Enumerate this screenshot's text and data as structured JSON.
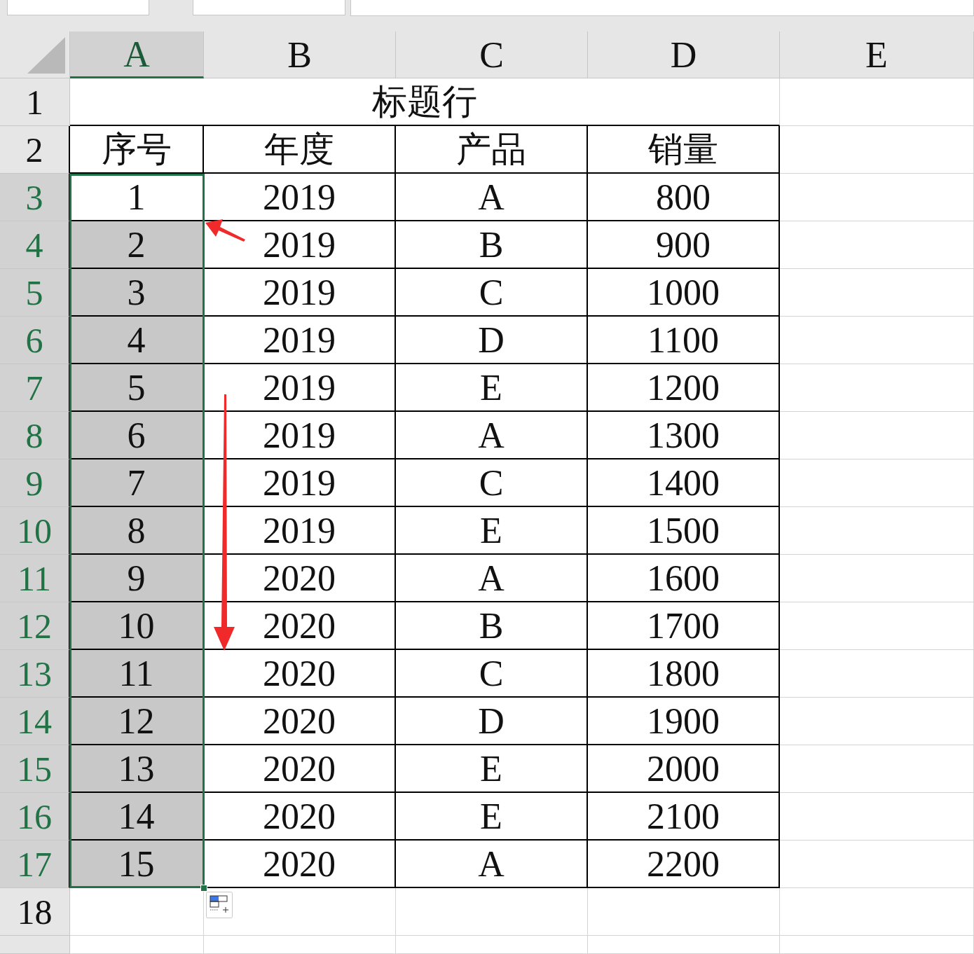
{
  "columns": [
    {
      "label": "A",
      "selected": true
    },
    {
      "label": "B",
      "selected": false
    },
    {
      "label": "C",
      "selected": false
    },
    {
      "label": "D",
      "selected": false
    },
    {
      "label": "E",
      "selected": false
    }
  ],
  "title": "标题行",
  "header_row": {
    "number": "2",
    "cells": [
      "序号",
      "年度",
      "产品",
      "销量"
    ]
  },
  "title_row_number": "1",
  "rows": [
    {
      "number": "3",
      "selected": true,
      "active": true,
      "cells": [
        "1",
        "2019",
        "A",
        "800"
      ]
    },
    {
      "number": "4",
      "selected": true,
      "active": false,
      "cells": [
        "2",
        "2019",
        "B",
        "900"
      ]
    },
    {
      "number": "5",
      "selected": true,
      "active": false,
      "cells": [
        "3",
        "2019",
        "C",
        "1000"
      ]
    },
    {
      "number": "6",
      "selected": true,
      "active": false,
      "cells": [
        "4",
        "2019",
        "D",
        "1100"
      ]
    },
    {
      "number": "7",
      "selected": true,
      "active": false,
      "cells": [
        "5",
        "2019",
        "E",
        "1200"
      ]
    },
    {
      "number": "8",
      "selected": true,
      "active": false,
      "cells": [
        "6",
        "2019",
        "A",
        "1300"
      ]
    },
    {
      "number": "9",
      "selected": true,
      "active": false,
      "cells": [
        "7",
        "2019",
        "C",
        "1400"
      ]
    },
    {
      "number": "10",
      "selected": true,
      "active": false,
      "cells": [
        "8",
        "2019",
        "E",
        "1500"
      ]
    },
    {
      "number": "11",
      "selected": true,
      "active": false,
      "cells": [
        "9",
        "2020",
        "A",
        "1600"
      ]
    },
    {
      "number": "12",
      "selected": true,
      "active": false,
      "cells": [
        "10",
        "2020",
        "B",
        "1700"
      ]
    },
    {
      "number": "13",
      "selected": true,
      "active": false,
      "cells": [
        "11",
        "2020",
        "C",
        "1800"
      ]
    },
    {
      "number": "14",
      "selected": true,
      "active": false,
      "cells": [
        "12",
        "2020",
        "D",
        "1900"
      ]
    },
    {
      "number": "15",
      "selected": true,
      "active": false,
      "cells": [
        "13",
        "2020",
        "E",
        "2000"
      ]
    },
    {
      "number": "16",
      "selected": true,
      "active": false,
      "cells": [
        "14",
        "2020",
        "E",
        "2100"
      ]
    },
    {
      "number": "17",
      "selected": true,
      "active": false,
      "cells": [
        "15",
        "2020",
        "A",
        "2200"
      ]
    }
  ],
  "empty_row_number": "18"
}
